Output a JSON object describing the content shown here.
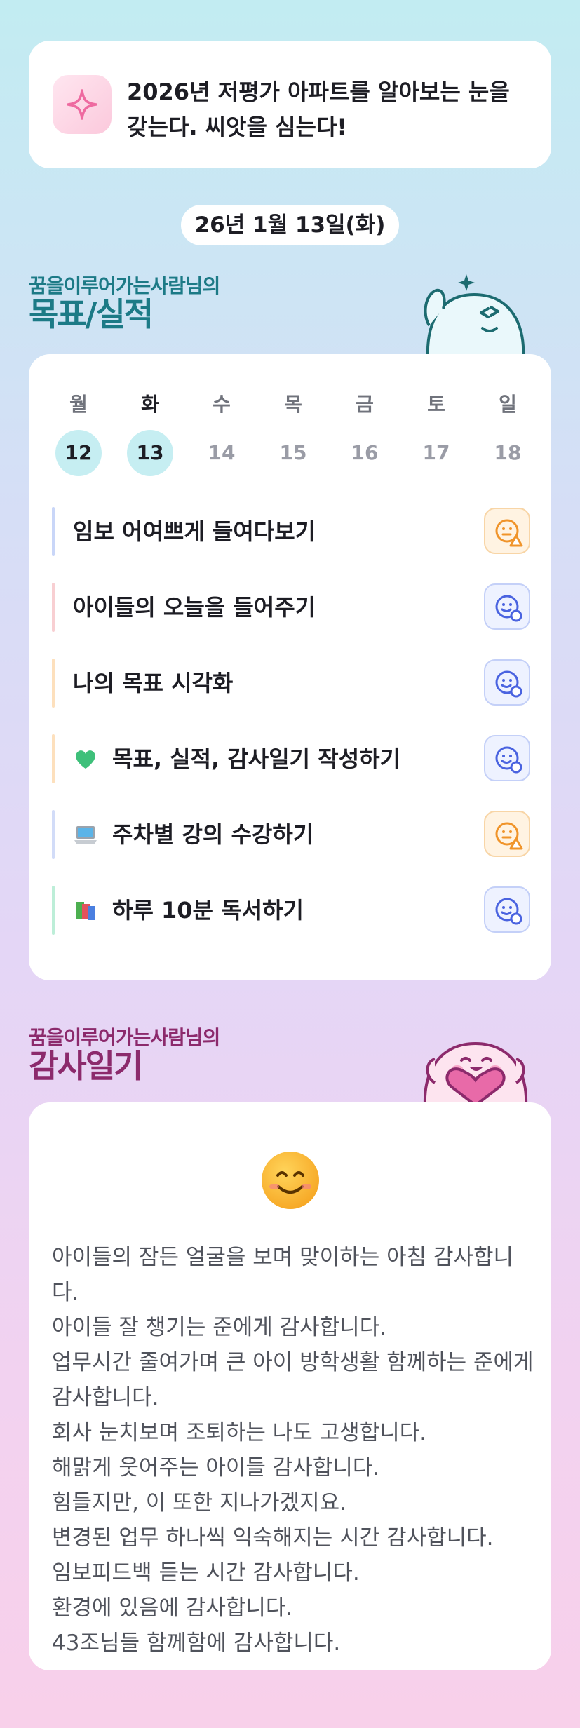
{
  "goal_banner": {
    "text": "2026년 저평가 아파트를 알아보는 눈을 갖는다. 씨앗을 심는다!",
    "icon": "sparkle-icon"
  },
  "date": "26년 1월 13일(화)",
  "goals_section": {
    "subtitle": "꿈을이루어가는사람님의",
    "title": "목표/실적"
  },
  "week": {
    "days": [
      {
        "name": "월",
        "num": "12",
        "done": true
      },
      {
        "name": "화",
        "num": "13",
        "done": true,
        "current": true
      },
      {
        "name": "수",
        "num": "14",
        "done": false
      },
      {
        "name": "목",
        "num": "15",
        "done": false
      },
      {
        "name": "금",
        "num": "16",
        "done": false
      },
      {
        "name": "토",
        "num": "17",
        "done": false
      },
      {
        "name": "일",
        "num": "18",
        "done": false
      }
    ]
  },
  "tasks": [
    {
      "label": "임보 어여쁘게 들여다보기",
      "emoji": null,
      "status": "warning",
      "bar_color": "#c9d6f8"
    },
    {
      "label": "아이들의 오늘을 들어주기",
      "emoji": null,
      "status": "complete",
      "bar_color": "#f8cfd2"
    },
    {
      "label": "나의 목표 시각화",
      "emoji": null,
      "status": "complete",
      "bar_color": "#fde0bd"
    },
    {
      "label": "목표, 실적, 감사일기 작성하기",
      "emoji": "green-heart",
      "status": "complete",
      "bar_color": "#fde0bd"
    },
    {
      "label": "주차별 강의 수강하기",
      "emoji": "laptop",
      "status": "warning",
      "bar_color": "#d2dcf8"
    },
    {
      "label": "하루 10분 독서하기",
      "emoji": "books",
      "status": "complete",
      "bar_color": "#bdeed8"
    }
  ],
  "diary_section": {
    "subtitle": "꿈을이루어가는사람님의",
    "title": "감사일기",
    "mood": "smiling-face",
    "lines": [
      "아이들의 잠든 얼굴을 보며 맞이하는 아침 감사합니다.",
      "아이들 잘 챙기는 준에게 감사합니다.",
      "업무시간 줄여가며 큰 아이 방학생활 함께하는 준에게 감사합니다.",
      "회사 눈치보며 조퇴하는 나도 고생합니다.",
      "해맑게 웃어주는 아이들 감사합니다.",
      "힘들지만, 이 또한 지나가겠지요.",
      "변경된 업무 하나씩 익숙해지는 시간 감사합니다.",
      "임보피드백 듣는 시간 감사합니다.",
      "환경에 있음에 감사합니다.",
      "43조님들 함께함에 감사합니다."
    ]
  },
  "colors": {
    "teal_heading": "#1c7a86",
    "plum_heading": "#8c2a6c",
    "status_complete": "#4a63e0",
    "status_warning": "#f0942a"
  }
}
